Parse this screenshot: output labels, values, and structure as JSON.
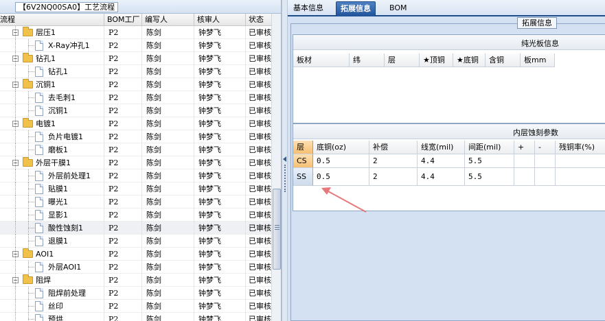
{
  "left": {
    "title": "【6V2NQ00SA0】工艺流程",
    "columns": [
      "流程",
      "BOM工厂",
      "编写人",
      "核审人",
      "状态"
    ],
    "rows": [
      {
        "level": 0,
        "type": "folder",
        "name": "层压1",
        "bom": "P2",
        "writer": "陈剑",
        "reviewer": "钟梦飞",
        "status": "已审核"
      },
      {
        "level": 1,
        "type": "doc",
        "name": "X-Ray冲孔1",
        "bom": "P2",
        "writer": "陈剑",
        "reviewer": "钟梦飞",
        "status": "已审核"
      },
      {
        "level": 0,
        "type": "folder",
        "name": "钻孔1",
        "bom": "P2",
        "writer": "陈剑",
        "reviewer": "钟梦飞",
        "status": "已审核"
      },
      {
        "level": 1,
        "type": "doc",
        "name": "钻孔1",
        "bom": "P2",
        "writer": "陈剑",
        "reviewer": "钟梦飞",
        "status": "已审核"
      },
      {
        "level": 0,
        "type": "folder",
        "name": "沉铜1",
        "bom": "P2",
        "writer": "陈剑",
        "reviewer": "钟梦飞",
        "status": "已审核"
      },
      {
        "level": 1,
        "type": "doc",
        "name": "去毛刺1",
        "bom": "P2",
        "writer": "陈剑",
        "reviewer": "钟梦飞",
        "status": "已审核"
      },
      {
        "level": 1,
        "type": "doc",
        "name": "沉铜1",
        "bom": "P2",
        "writer": "陈剑",
        "reviewer": "钟梦飞",
        "status": "已审核"
      },
      {
        "level": 0,
        "type": "folder",
        "name": "电镀1",
        "bom": "P2",
        "writer": "陈剑",
        "reviewer": "钟梦飞",
        "status": "已审核"
      },
      {
        "level": 1,
        "type": "doc",
        "name": "负片电镀1",
        "bom": "P2",
        "writer": "陈剑",
        "reviewer": "钟梦飞",
        "status": "已审核"
      },
      {
        "level": 1,
        "type": "doc",
        "name": "磨板1",
        "bom": "P2",
        "writer": "陈剑",
        "reviewer": "钟梦飞",
        "status": "已审核"
      },
      {
        "level": 0,
        "type": "folder",
        "name": "外层干膜1",
        "bom": "P2",
        "writer": "陈剑",
        "reviewer": "钟梦飞",
        "status": "已审核"
      },
      {
        "level": 1,
        "type": "doc",
        "name": "外层前处理1",
        "bom": "P2",
        "writer": "陈剑",
        "reviewer": "钟梦飞",
        "status": "已审核"
      },
      {
        "level": 1,
        "type": "doc",
        "name": "贴膜1",
        "bom": "P2",
        "writer": "陈剑",
        "reviewer": "钟梦飞",
        "status": "已审核"
      },
      {
        "level": 1,
        "type": "doc",
        "name": "曝光1",
        "bom": "P2",
        "writer": "陈剑",
        "reviewer": "钟梦飞",
        "status": "已审核"
      },
      {
        "level": 1,
        "type": "doc",
        "name": "显影1",
        "bom": "P2",
        "writer": "陈剑",
        "reviewer": "钟梦飞",
        "status": "已审核"
      },
      {
        "level": 1,
        "type": "doc",
        "name": "酸性蚀刻1",
        "bom": "P2",
        "writer": "陈剑",
        "reviewer": "钟梦飞",
        "status": "已审核",
        "selected": true
      },
      {
        "level": 1,
        "type": "doc",
        "name": "退膜1",
        "bom": "P2",
        "writer": "陈剑",
        "reviewer": "钟梦飞",
        "status": "已审核"
      },
      {
        "level": 0,
        "type": "folder",
        "name": "AOI1",
        "bom": "P2",
        "writer": "陈剑",
        "reviewer": "钟梦飞",
        "status": "已审核"
      },
      {
        "level": 1,
        "type": "doc",
        "name": "外层AOI1",
        "bom": "P2",
        "writer": "陈剑",
        "reviewer": "钟梦飞",
        "status": "已审核"
      },
      {
        "level": 0,
        "type": "folder",
        "name": "阻焊",
        "bom": "P2",
        "writer": "陈剑",
        "reviewer": "钟梦飞",
        "status": "已审核"
      },
      {
        "level": 1,
        "type": "doc",
        "name": "阻焊前处理",
        "bom": "P2",
        "writer": "陈剑",
        "reviewer": "钟梦飞",
        "status": "已审核"
      },
      {
        "level": 1,
        "type": "doc",
        "name": "丝印",
        "bom": "P2",
        "writer": "陈剑",
        "reviewer": "钟梦飞",
        "status": "已审核"
      },
      {
        "level": 1,
        "type": "doc",
        "name": "预烘",
        "bom": "P2",
        "writer": "陈剑",
        "reviewer": "钟梦飞",
        "status": "已审核"
      }
    ]
  },
  "tabs": [
    {
      "label": "基本信息",
      "active": false
    },
    {
      "label": "拓展信息",
      "active": true
    },
    {
      "label": "BOM",
      "active": false
    }
  ],
  "group_title": "拓展信息",
  "board_panel": {
    "title": "纯光板信息",
    "columns": [
      "板材",
      "纬",
      "层",
      "★顶铜",
      "★底铜",
      "含铜",
      "板mm"
    ]
  },
  "etch_panel": {
    "title": "内层蚀刻参数",
    "columns": [
      "层",
      "底铜(oz)",
      "补偿",
      "线宽(mil)",
      "间距(mil)",
      "+",
      "-",
      "残铜率(%)"
    ],
    "rows": [
      {
        "layer": "CS",
        "base_copper": "0.5",
        "compensation": "2",
        "line_width": "4.4",
        "spacing": "5.5",
        "plus": "",
        "minus": "",
        "residual": ""
      },
      {
        "layer": "SS",
        "base_copper": "0.5",
        "compensation": "2",
        "line_width": "4.4",
        "spacing": "5.5",
        "plus": "",
        "minus": "",
        "residual": ""
      }
    ]
  },
  "colors": {
    "accent_tab": "#1f5297",
    "annotation_arrow": "#e5787a",
    "row_header": "#f6c074"
  }
}
